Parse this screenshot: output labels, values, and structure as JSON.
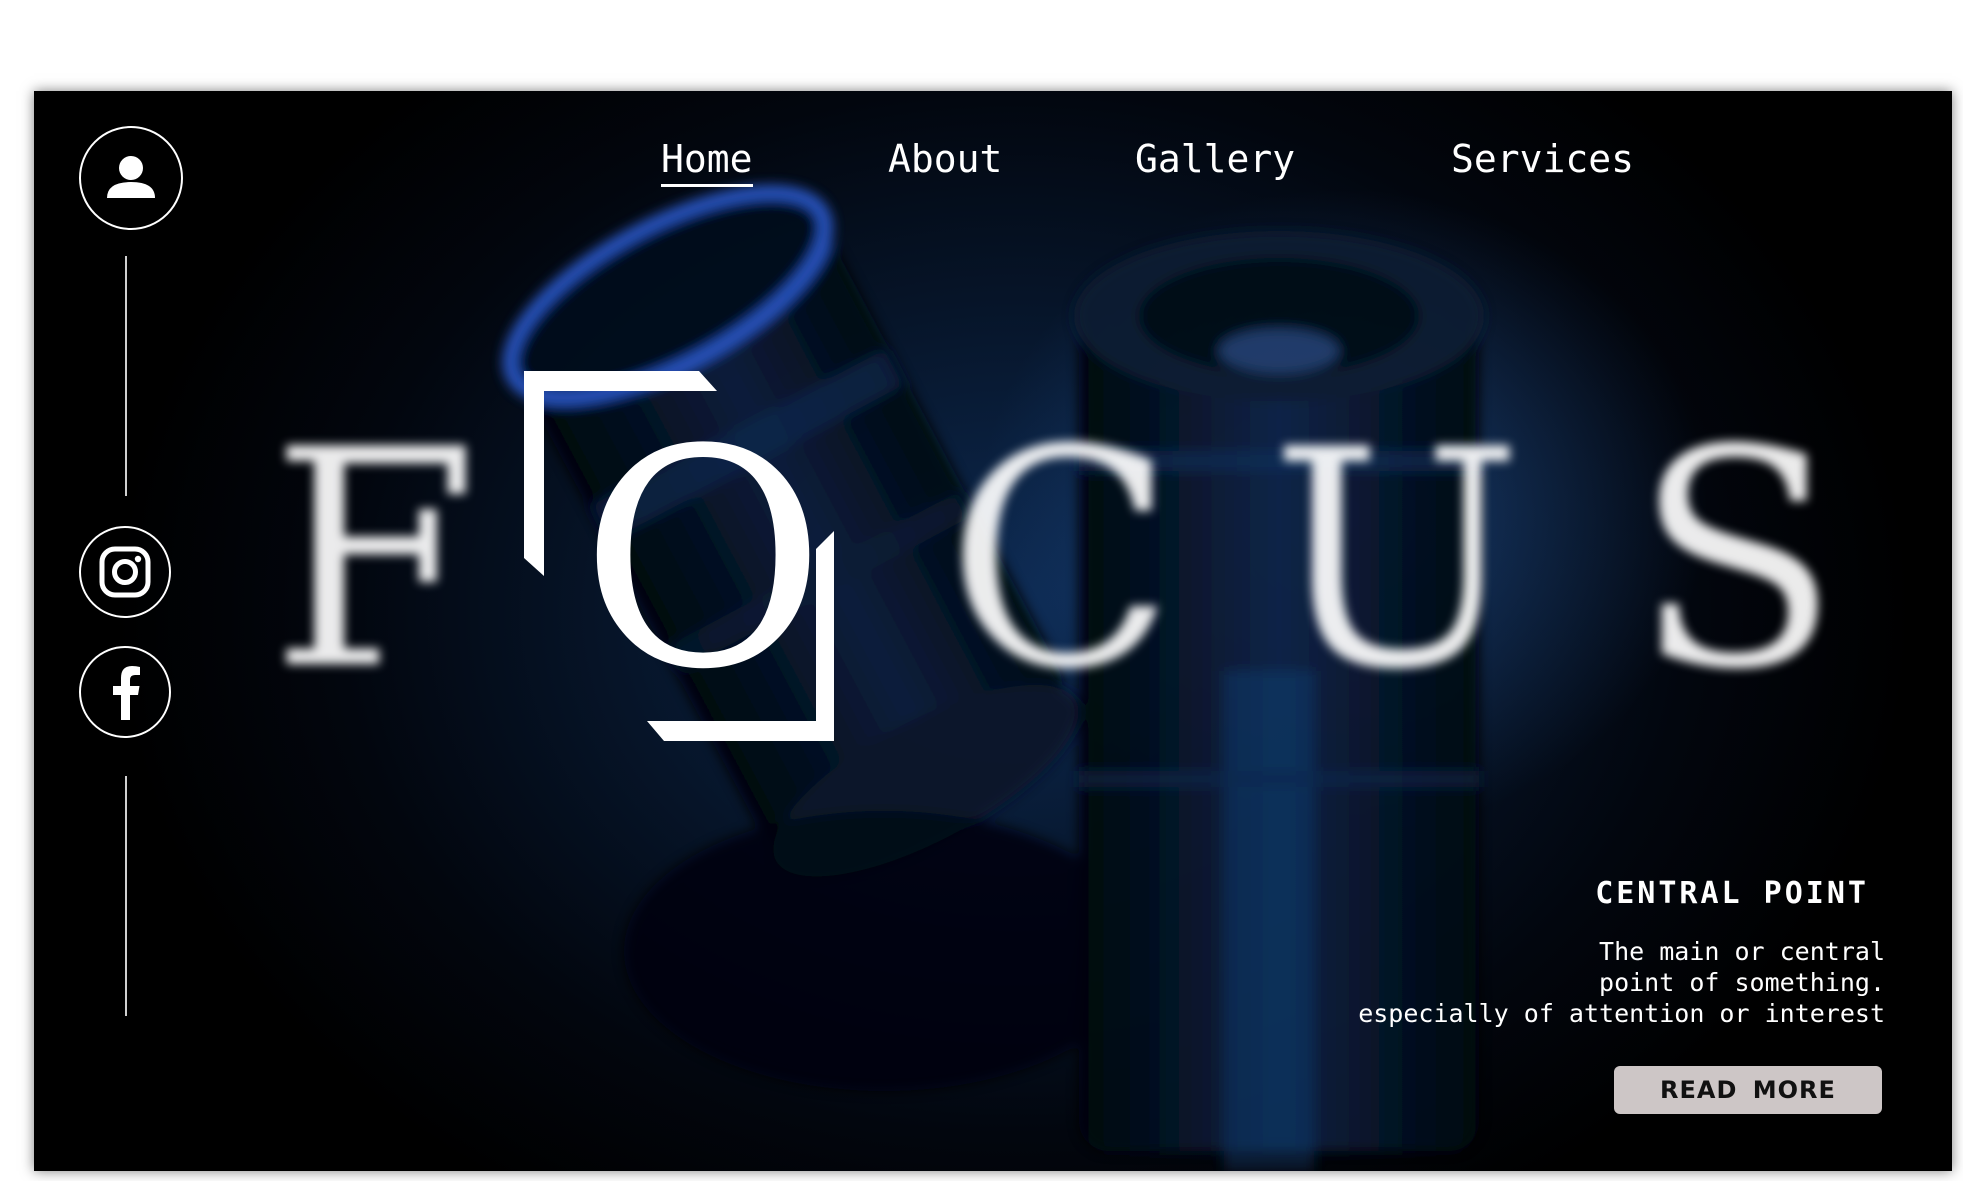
{
  "nav": {
    "items": [
      {
        "label": "Home",
        "active": true
      },
      {
        "label": "About"
      },
      {
        "label": "Gallery"
      },
      {
        "label": "Services"
      }
    ]
  },
  "sidebar": {
    "icons": [
      "user-icon",
      "instagram-icon",
      "facebook-icon"
    ]
  },
  "hero": {
    "letters": [
      "F",
      "O",
      "C",
      "U",
      "S"
    ]
  },
  "info": {
    "title": "CENTRAL POINT",
    "lines": [
      "The main or central",
      "point of something.",
      "especially of attention or interest"
    ],
    "button_label": "READ MORE"
  },
  "colors": {
    "background": "#020a18",
    "accent_blue": "#1f4f9a",
    "text": "#ffffff",
    "button_bg": "#cdc6c6"
  }
}
